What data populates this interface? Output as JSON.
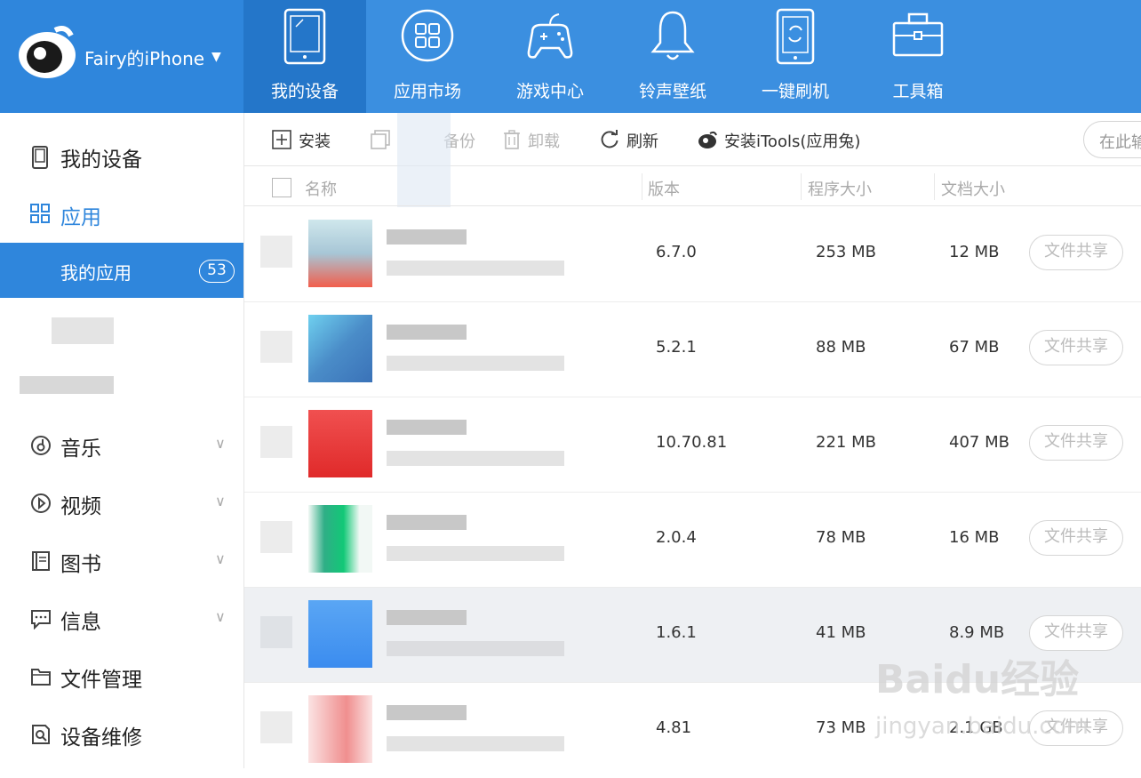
{
  "header": {
    "device_name": "Fairy的iPhone",
    "nav": [
      {
        "label": "我的设备",
        "icon": "phone-icon",
        "active": true
      },
      {
        "label": "应用市场",
        "icon": "app-grid-icon",
        "active": false
      },
      {
        "label": "游戏中心",
        "icon": "gamepad-icon",
        "active": false
      },
      {
        "label": "铃声壁纸",
        "icon": "bell-icon",
        "active": false
      },
      {
        "label": "一键刷机",
        "icon": "flash-phone-icon",
        "active": false
      },
      {
        "label": "工具箱",
        "icon": "toolbox-icon",
        "active": false
      }
    ]
  },
  "sidebar": {
    "my_device": "我的设备",
    "apps": "应用",
    "my_apps": "我的应用",
    "my_apps_count": "53",
    "music": "音乐",
    "video": "视频",
    "books": "图书",
    "messages": "信息",
    "file_manager": "文件管理",
    "device_repair": "设备维修"
  },
  "toolbar": {
    "install": "安装",
    "backup": "备份",
    "uninstall": "卸载",
    "refresh": "刷新",
    "install_itools": "安装iTools(应用兔)",
    "search_placeholder": "在此输"
  },
  "table": {
    "headers": {
      "name": "名称",
      "version": "版本",
      "app_size": "程序大小",
      "doc_size": "文档大小"
    },
    "share_label": "文件共享",
    "rows": [
      {
        "version": "6.7.0",
        "app_size": "253 MB",
        "doc_size": "12 MB"
      },
      {
        "version": "5.2.1",
        "app_size": "88 MB",
        "doc_size": "67 MB"
      },
      {
        "version": "10.70.81",
        "app_size": "221 MB",
        "doc_size": "407 MB"
      },
      {
        "version": "2.0.4",
        "app_size": "78 MB",
        "doc_size": "16 MB"
      },
      {
        "version": "1.6.1",
        "app_size": "41 MB",
        "doc_size": "8.9 MB"
      },
      {
        "version": "4.81",
        "app_size": "73 MB",
        "doc_size": "2.1 GB"
      }
    ]
  },
  "watermark": {
    "brand": "Baidu经验",
    "url": "jingyan.baidu.com"
  },
  "colors": {
    "accent": "#2f86dc",
    "topbar": "#3b8fe0",
    "active_tab": "#2476c9"
  }
}
